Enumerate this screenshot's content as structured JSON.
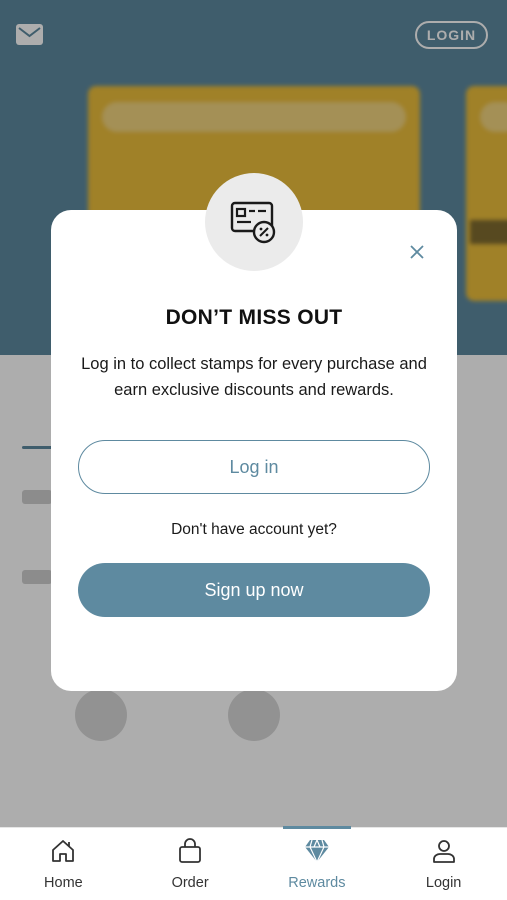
{
  "header": {
    "login_label": "LOGIN"
  },
  "modal": {
    "title": "DON’T MISS OUT",
    "description": "Log in to collect stamps for every purchase and earn exclusive discounts and rewards.",
    "login_button": "Log in",
    "no_account_text": "Don't have account yet?",
    "signup_button": "Sign up now",
    "icon": "loyalty-card-discount-icon"
  },
  "bottom_nav": {
    "items": [
      {
        "label": "Home",
        "icon": "home-icon",
        "active": false
      },
      {
        "label": "Order",
        "icon": "bag-icon",
        "active": false
      },
      {
        "label": "Rewards",
        "icon": "diamond-icon",
        "active": true
      },
      {
        "label": "Login",
        "icon": "user-icon",
        "active": false
      }
    ]
  },
  "colors": {
    "accent": "#5e8aa0",
    "card": "#ecbe3b",
    "overlay": "rgba(0,0,0,0.32)"
  }
}
